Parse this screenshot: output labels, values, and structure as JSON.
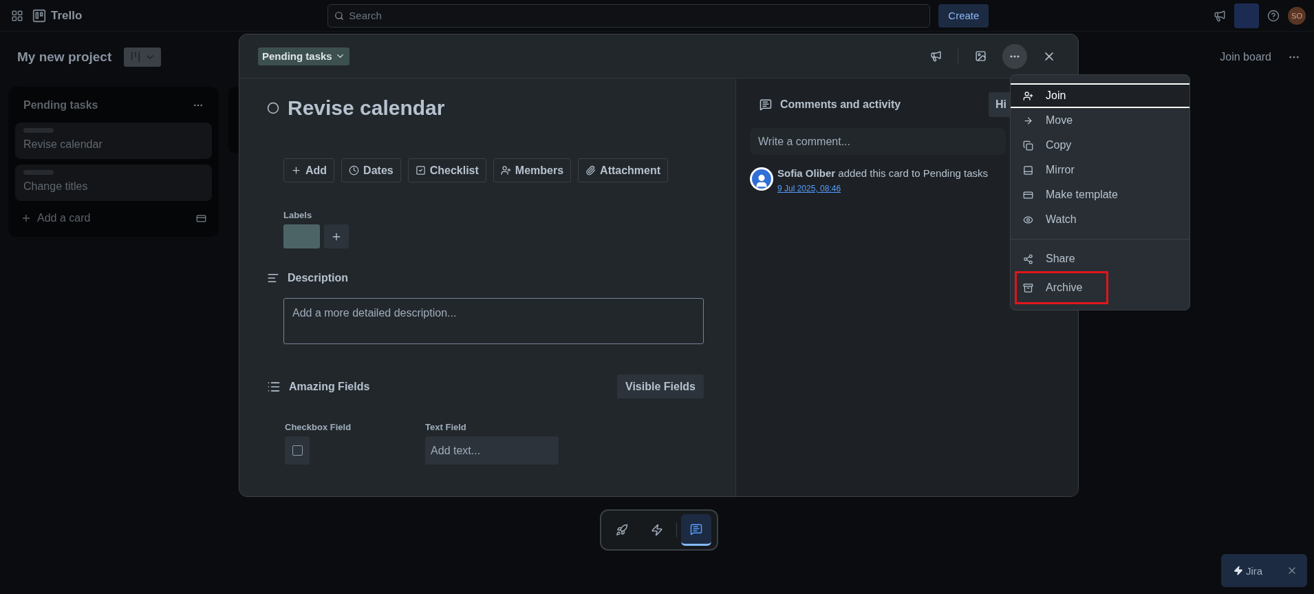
{
  "top_bar": {
    "app_name": "Trello",
    "search": {
      "placeholder": "Search"
    },
    "create_button": "Create",
    "avatar_initials": "SO"
  },
  "board": {
    "title": "My new project",
    "join_button": "Join board"
  },
  "lists": [
    {
      "title": "Pending tasks",
      "cards": [
        {
          "title": "Revise calendar"
        },
        {
          "title": "Change titles"
        }
      ],
      "add_card": "Add a card"
    }
  ],
  "card_modal": {
    "list_chip": "Pending tasks",
    "title": "Revise calendar",
    "completed": false,
    "actions": [
      "Add",
      "Dates",
      "Checklist",
      "Members",
      "Attachment"
    ],
    "labels": {
      "heading": "Labels"
    },
    "description": {
      "heading": "Description",
      "placeholder": "Add a more detailed description..."
    },
    "custom_fields": {
      "title": "Amazing Fields",
      "button": "Visible Fields",
      "fields": [
        {
          "kind": "checkbox",
          "label": "Checkbox Field",
          "checked": false
        },
        {
          "kind": "text",
          "label": "Text Field",
          "placeholder": "Add text..."
        }
      ]
    },
    "activity": {
      "heading": "Comments and activity",
      "hide_button": "Hi",
      "comment_placeholder": "Write a comment...",
      "entries": [
        {
          "author": "Sofia Oliber",
          "text": "added this card to Pending tasks",
          "time": "9 Jul 2025, 08:46"
        }
      ]
    }
  },
  "menu": {
    "groups": [
      [
        {
          "label": "Join",
          "selected": true,
          "highlighted": false
        },
        {
          "label": "Move",
          "selected": false,
          "highlighted": false
        },
        {
          "label": "Copy",
          "selected": false,
          "highlighted": false
        },
        {
          "label": "Mirror",
          "selected": false,
          "highlighted": false
        },
        {
          "label": "Make template",
          "selected": false,
          "highlighted": false
        },
        {
          "label": "Watch",
          "selected": false,
          "highlighted": false
        }
      ],
      [
        {
          "label": "Share",
          "selected": false,
          "highlighted": false
        },
        {
          "label": "Archive",
          "selected": false,
          "highlighted": true
        }
      ]
    ]
  },
  "bottom_toolbar": {
    "buttons": [
      {
        "selected": false
      },
      {
        "selected": false
      },
      {
        "selected": true
      }
    ]
  },
  "jira": {
    "label": "Jira"
  }
}
